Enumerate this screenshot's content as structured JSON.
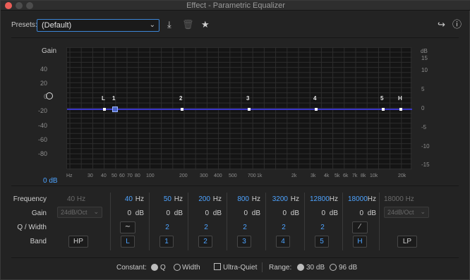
{
  "window": {
    "title": "Effect - Parametric Equalizer"
  },
  "presets": {
    "label": "Presets:",
    "value": "(Default)"
  },
  "graph": {
    "gain_label": "Gain",
    "db_label": "dB",
    "gain_ticks": [
      "40",
      "20",
      "0",
      "-20",
      "-40",
      "-60",
      "-80"
    ],
    "bottom_db": "0 dB",
    "right_ticks": [
      "15",
      "10",
      "5",
      "0",
      "-5",
      "-10",
      "-15"
    ],
    "freq_ticks": [
      "Hz",
      "30",
      "40",
      "50",
      "60",
      "70",
      "80",
      "100",
      "200",
      "300",
      "400",
      "500",
      "700",
      "1k",
      "2k",
      "3k",
      "4k",
      "5k",
      "6k",
      "7k",
      "8k",
      "10k",
      "20k"
    ],
    "node_labels": [
      "L",
      "1",
      "2",
      "3",
      "4",
      "5",
      "H"
    ],
    "curve_color": "#3a35c8"
  },
  "controls": {
    "row_labels": {
      "frequency": "Frequency",
      "gain": "Gain",
      "q": "Q / Width",
      "band": "Band"
    },
    "hp": {
      "freq": "40 Hz",
      "gain": "24dB/Oct",
      "band": "HP"
    },
    "bands": [
      {
        "freq": "40",
        "gain": "0",
        "q": "",
        "band": "L"
      },
      {
        "freq": "50",
        "gain": "0",
        "q": "2",
        "band": "1"
      },
      {
        "freq": "200",
        "gain": "0",
        "q": "2",
        "band": "2"
      },
      {
        "freq": "800",
        "gain": "0",
        "q": "2",
        "band": "3"
      },
      {
        "freq": "3200",
        "gain": "0",
        "q": "2",
        "band": "4"
      },
      {
        "freq": "12800",
        "gain": "0",
        "q": "2",
        "band": "5"
      },
      {
        "freq": "18000",
        "gain": "0",
        "q": "",
        "band": "H"
      }
    ],
    "unit_hz": "Hz",
    "unit_db": "dB",
    "lp": {
      "freq": "18000 Hz",
      "gain": "24dB/Oct",
      "band": "LP"
    }
  },
  "footer": {
    "constant_label": "Constant:",
    "q_label": "Q",
    "width_label": "Width",
    "ultra_quiet_label": "Ultra-Quiet",
    "range_label": "Range:",
    "range_30": "30 dB",
    "range_96": "96 dB"
  }
}
